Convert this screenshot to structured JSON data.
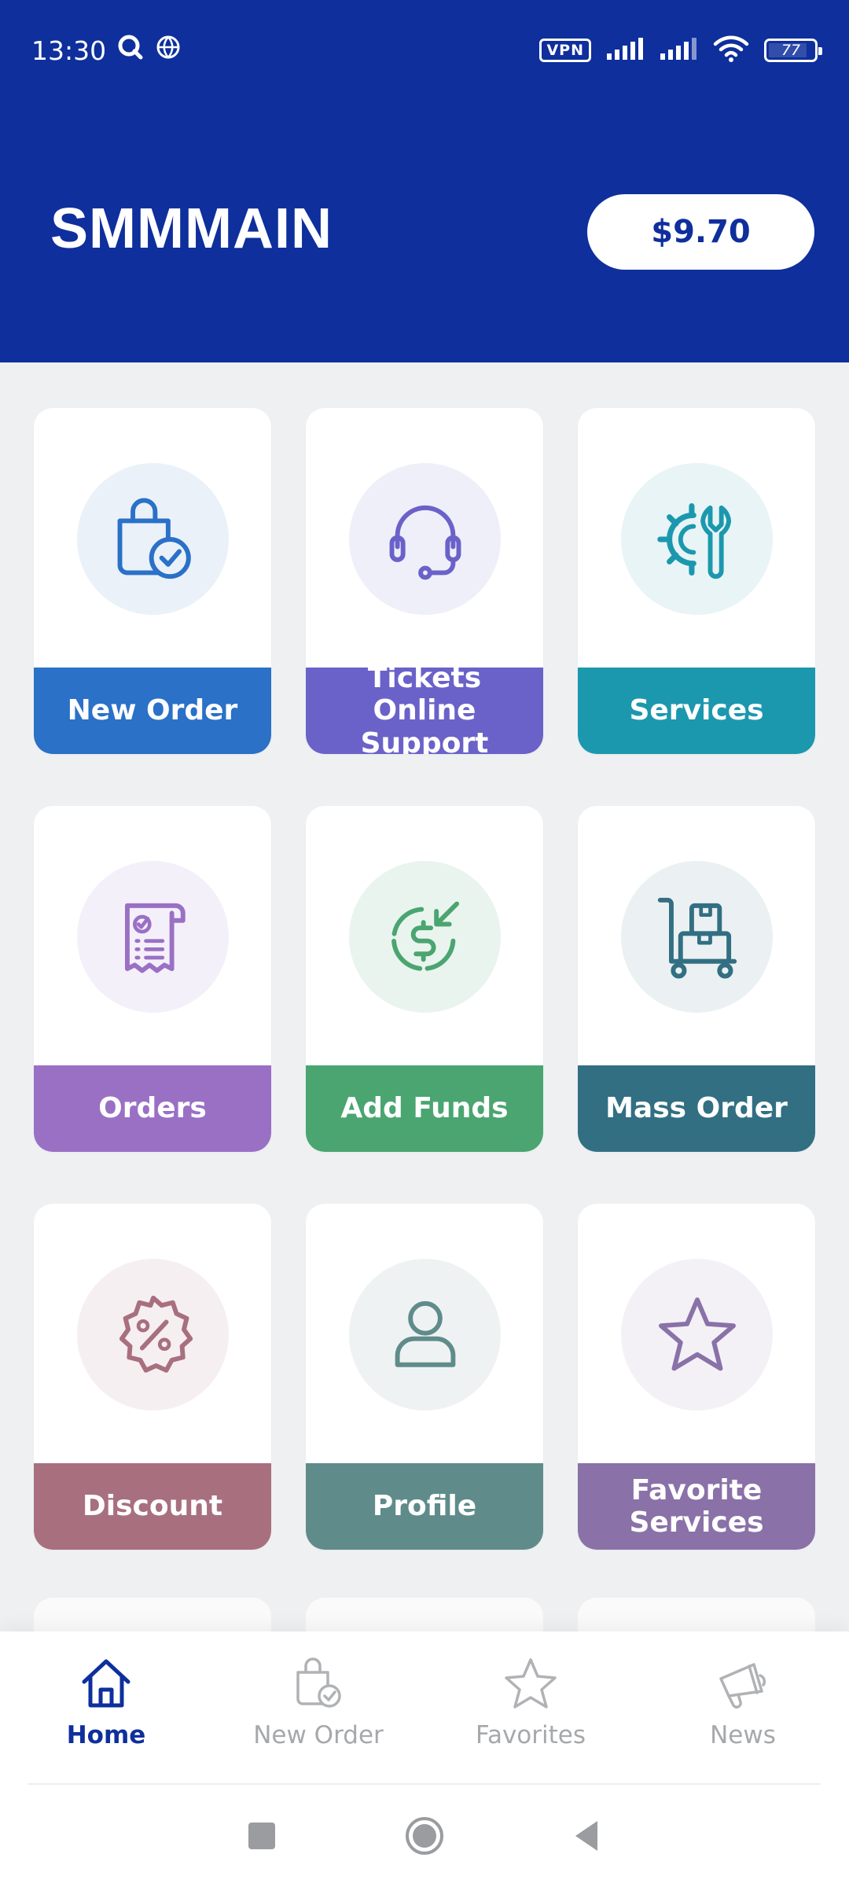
{
  "status_bar": {
    "time": "13:30",
    "vpn": "VPN",
    "battery": "77",
    "battery_level": 0.77
  },
  "header": {
    "title": "SMMMAIN",
    "balance": "$9.70"
  },
  "tiles": [
    {
      "label": "New Order",
      "icon": "shopping-bag-check-icon",
      "color": "#2a71c7",
      "circle": "#eaf1f9"
    },
    {
      "label": "Tickets Online Support",
      "icon": "headset-icon",
      "color": "#6a62c9",
      "circle": "#efeff9"
    },
    {
      "label": "Services",
      "icon": "gear-wrench-icon",
      "color": "#1c98ae",
      "circle": "#e8f4f6"
    },
    {
      "label": "Orders",
      "icon": "receipt-icon",
      "color": "#9a70c5",
      "circle": "#f4f0f9"
    },
    {
      "label": "Add Funds",
      "icon": "dollar-refresh-icon",
      "color": "#4aa571",
      "circle": "#eaf4ee"
    },
    {
      "label": "Mass Order",
      "icon": "cart-boxes-icon",
      "color": "#326f82",
      "circle": "#ebf0f2"
    },
    {
      "label": "Discount",
      "icon": "percent-badge-icon",
      "color": "#a8707e",
      "circle": "#f6eff1"
    },
    {
      "label": "Profile",
      "icon": "user-icon",
      "color": "#5f8c8a",
      "circle": "#eff2f3"
    },
    {
      "label": "Favorite Services",
      "icon": "star-icon",
      "color": "#8a71a8",
      "circle": "#f3f1f6"
    }
  ],
  "bottom_nav": [
    {
      "label": "Home",
      "icon": "home-icon",
      "active": true
    },
    {
      "label": "New Order",
      "icon": "shopping-bag-check-icon",
      "active": false
    },
    {
      "label": "Favorites",
      "icon": "star-icon",
      "active": false
    },
    {
      "label": "News",
      "icon": "megaphone-icon",
      "active": false
    }
  ],
  "colors": {
    "brand": "#0e2f9c",
    "background": "#eef0f2",
    "inactive_nav": "#a6a8ab"
  }
}
